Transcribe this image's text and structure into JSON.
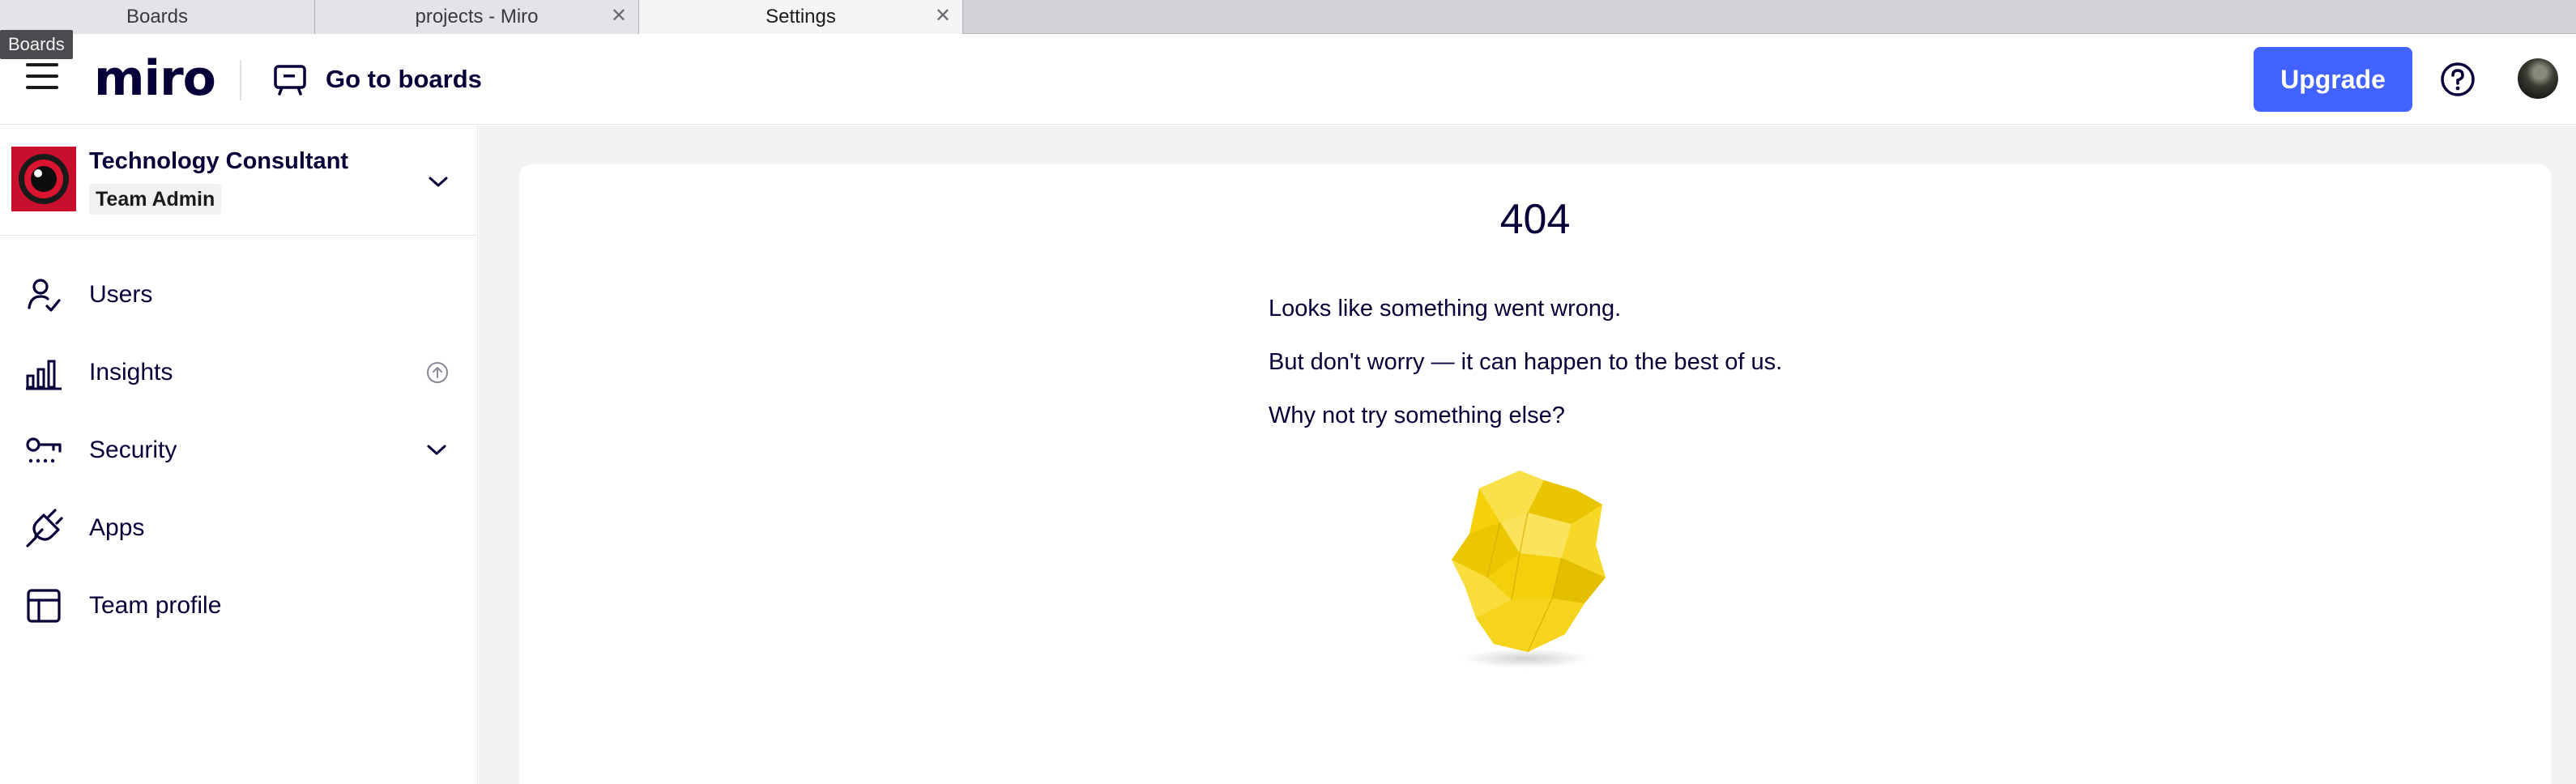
{
  "browser": {
    "tabs": [
      {
        "label": "Boards"
      },
      {
        "label": "projects - Miro"
      },
      {
        "label": "Settings"
      }
    ],
    "tooltip": "Boards"
  },
  "header": {
    "logo": "miro",
    "go_to_boards": "Go to boards",
    "upgrade": "Upgrade"
  },
  "sidebar": {
    "team_name": "Technology Consultant",
    "team_role": "Team Admin",
    "items": [
      {
        "label": "Users",
        "icon": "user-check-icon"
      },
      {
        "label": "Insights",
        "icon": "bar-chart-icon"
      },
      {
        "label": "Security",
        "icon": "key-icon"
      },
      {
        "label": "Apps",
        "icon": "plug-icon"
      },
      {
        "label": "Team profile",
        "icon": "layout-icon"
      }
    ]
  },
  "main": {
    "code": "404",
    "line1": "Looks like something went wrong.",
    "line2": "But don't worry — it can happen to the best of us.",
    "line3": "Why not try something else?"
  },
  "colors": {
    "accent": "#4262ff",
    "team_logo": "#c8102e",
    "sticky_note": "#f5d10a"
  }
}
